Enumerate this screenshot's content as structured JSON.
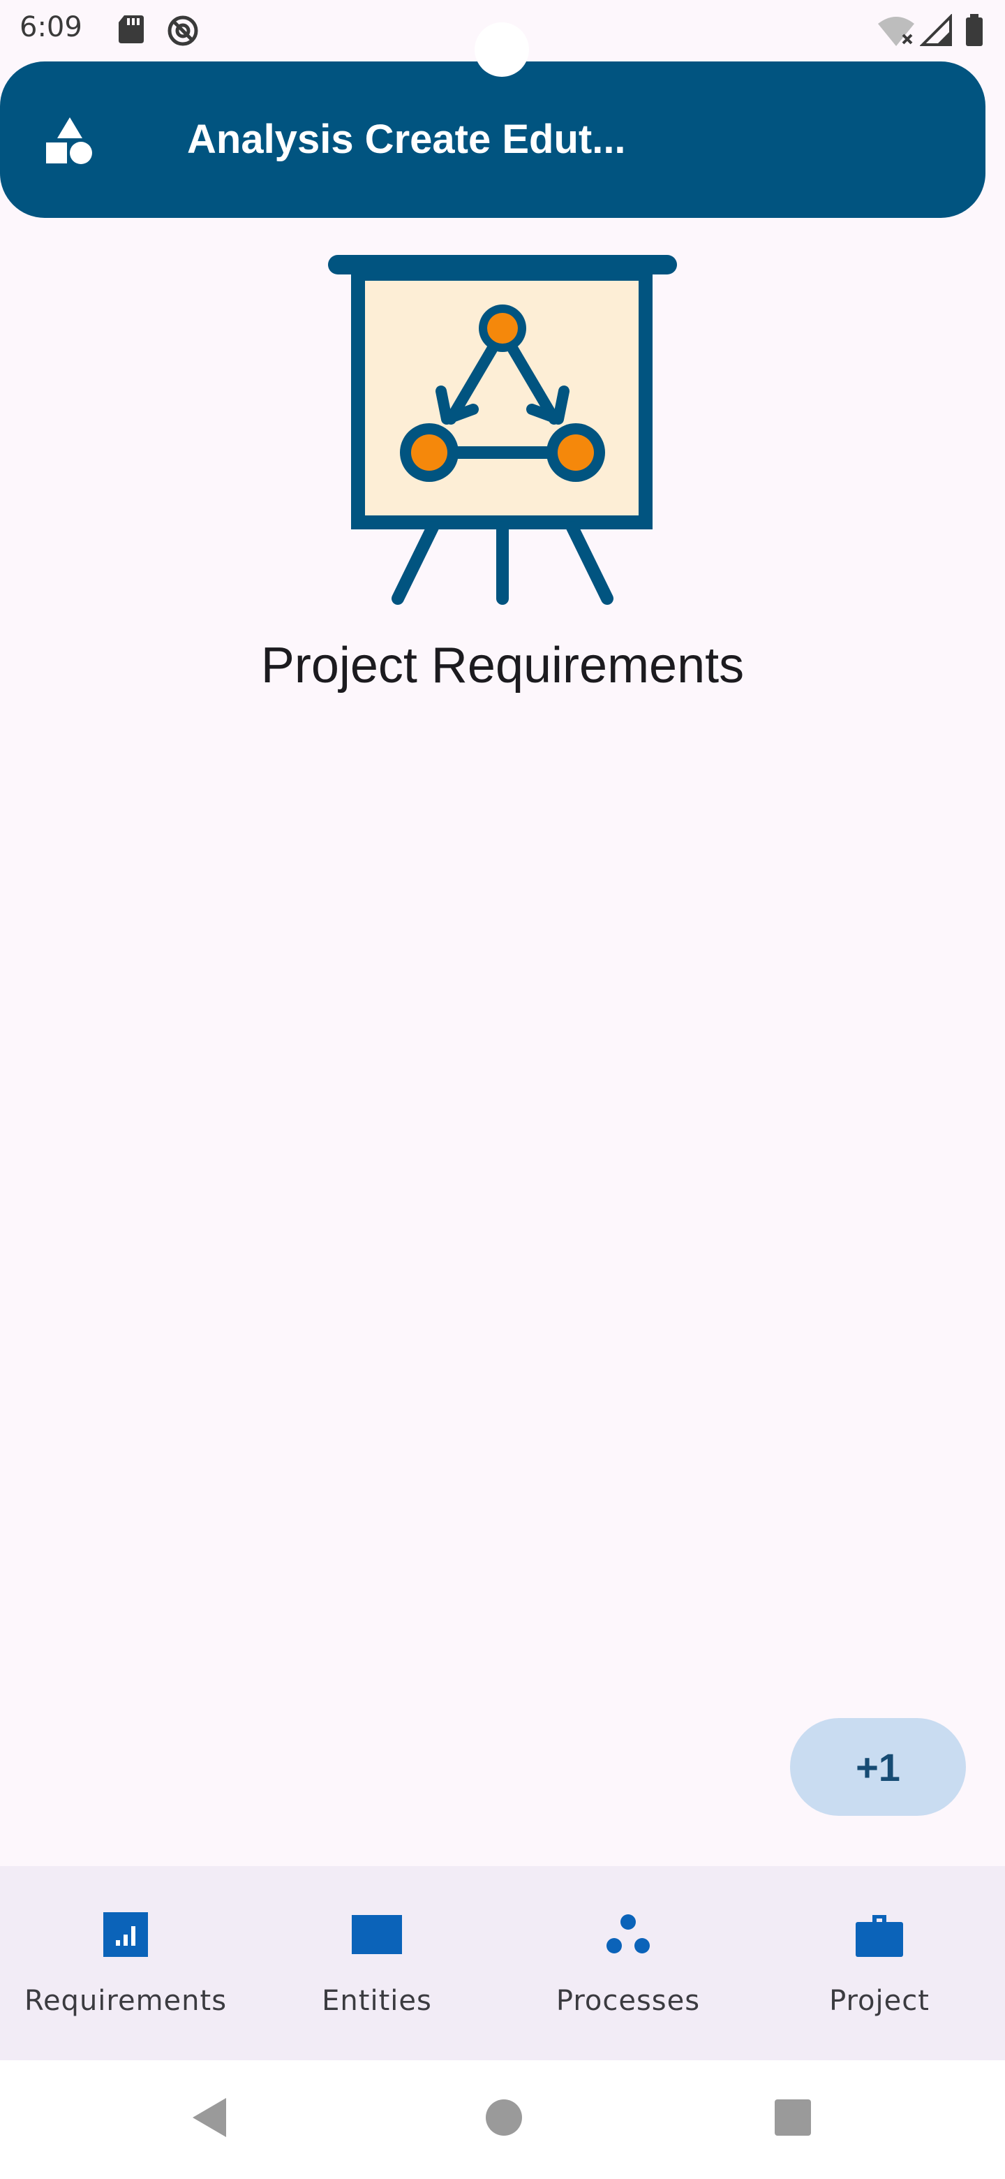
{
  "status_bar": {
    "time": "6:09",
    "icons": [
      "sd-card-icon",
      "do-not-disturb-icon",
      "wifi-off-icon",
      "signal-icon",
      "battery-icon"
    ]
  },
  "app_bar": {
    "title": "Analysis Create Edut...",
    "icon": "shapes-icon",
    "background": "#015480"
  },
  "main": {
    "illustration": "presentation-board-icon",
    "heading": "Project Requirements"
  },
  "fab": {
    "label": "+1",
    "background": "#C9DCF1"
  },
  "bottom_nav": {
    "items": [
      {
        "label": "Requirements",
        "icon": "bar-chart-icon"
      },
      {
        "label": "Entities",
        "icon": "rectangle-icon"
      },
      {
        "label": "Processes",
        "icon": "circles-icon"
      },
      {
        "label": "Project",
        "icon": "briefcase-icon"
      }
    ]
  },
  "system_nav": {
    "buttons": [
      "back-icon",
      "home-icon",
      "recents-icon"
    ]
  },
  "colors": {
    "accent": "#015480",
    "icon_blue": "#0B63B9",
    "orange": "#F5880B",
    "board_fill": "#FDEED6"
  }
}
